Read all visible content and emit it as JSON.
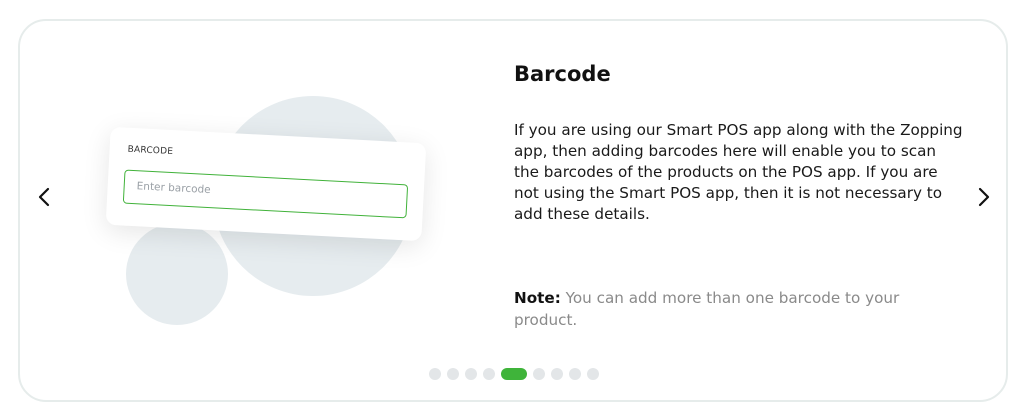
{
  "colors": {
    "accent": "#3fb43a",
    "card_border": "#e6eceb",
    "dot_inactive": "#e3e6e8",
    "circle": "#e6ecef",
    "note_text": "#8a8a8a"
  },
  "nav": {
    "prev_icon": "chevron-left-icon",
    "next_icon": "chevron-right-icon"
  },
  "illustration": {
    "field_label": "BARCODE",
    "input_placeholder": "Enter barcode"
  },
  "slide": {
    "title": "Barcode",
    "description": "If you are using our Smart POS app along with the Zopping app, then adding barcodes here will enable you to scan the barcodes of the products on the POS app. If you are not using the Smart POS app, then it is not necessary to add these details.",
    "note_label": "Note:",
    "note_text": " You can add more than one barcode to your product."
  },
  "pagination": {
    "total": 9,
    "active_index": 4
  }
}
